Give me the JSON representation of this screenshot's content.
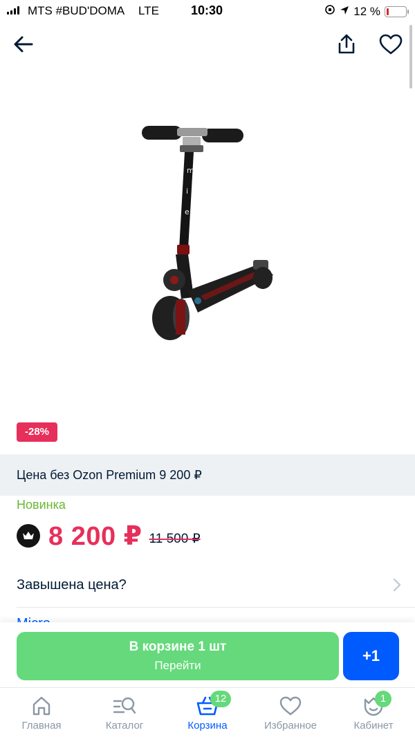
{
  "status_bar": {
    "carrier": "MTS #BUD'DOMA",
    "network": "LTE",
    "time": "10:30",
    "battery_percent": "12 %",
    "battery_level": 0.12
  },
  "header": {
    "back_icon": "arrow-left-icon",
    "share_icon": "share-icon",
    "favorite_icon": "heart-icon"
  },
  "product": {
    "image_icon": "scooter-image",
    "discount_badge": "-28%",
    "premium_price_text": "Цена без Ozon Premium 9 200 ₽",
    "novelty_label": "Новинка",
    "price": "8 200 ₽",
    "old_price": "11 500 ₽",
    "overpriced_text": "Завышена цена?",
    "brand_partial": "Micro"
  },
  "cart_action": {
    "in_cart_label": "В корзине 1 шт",
    "go_label": "Перейти",
    "plus_label": "+1"
  },
  "tabbar": {
    "tabs": [
      {
        "label": "Главная",
        "icon": "home-icon"
      },
      {
        "label": "Каталог",
        "icon": "catalog-search-icon"
      },
      {
        "label": "Корзина",
        "icon": "basket-icon",
        "badge": "12"
      },
      {
        "label": "Избранное",
        "icon": "heart-icon"
      },
      {
        "label": "Кабинет",
        "icon": "profile-icon",
        "badge": "1"
      }
    ]
  },
  "colors": {
    "accent_blue": "#005bff",
    "price_pink": "#e72f5b",
    "green": "#65d97b",
    "novelty_green": "#69b833"
  }
}
